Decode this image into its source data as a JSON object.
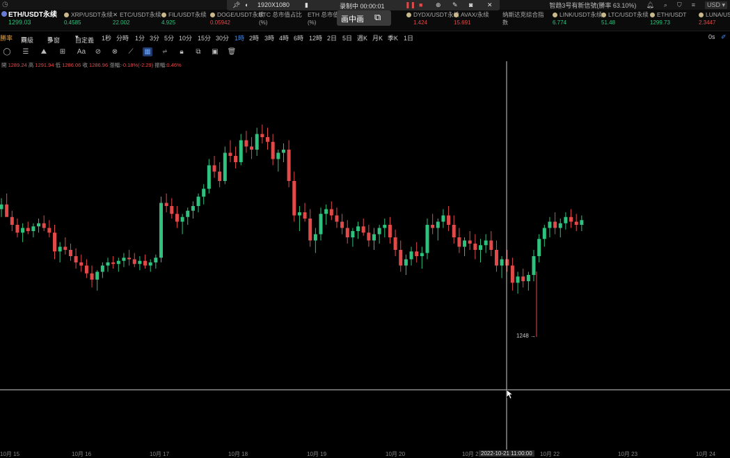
{
  "topbar": {
    "status_text": "智趋3号有新信號(勝率 63.10%)",
    "currency": "USD"
  },
  "tickers": [
    {
      "name": "ETH/USDT永续",
      "price": "1299.03",
      "dir": "up"
    },
    {
      "name": "XRP/USDT永续",
      "price": "0.4585",
      "dir": "up"
    },
    {
      "name": "ETC/USDT永续",
      "price": "22.002",
      "dir": "up"
    },
    {
      "name": "FIL/USDT永续",
      "price": "4.925",
      "dir": "up"
    },
    {
      "name": "DOGE/USDT永续",
      "price": "0.05942",
      "dir": "dn"
    },
    {
      "name": "BTC 总市值占比",
      "price": "(%)",
      "dir": "none"
    },
    {
      "name": "ETH 总市值",
      "price": "(%)",
      "dir": "none"
    },
    {
      "name": "DYDX/USDT永续",
      "price": "1.424",
      "dir": "dn"
    },
    {
      "name": "AVAX/永续",
      "price": "15.691",
      "dir": "dn"
    },
    {
      "name": "纳斯达克综合指",
      "price": "数",
      "dir": "none"
    },
    {
      "name": "LINK/USDT永续",
      "price": "6.774",
      "dir": "up"
    },
    {
      "name": "LTC/USDT永续",
      "price": "51.48",
      "dir": "up"
    },
    {
      "name": "ETH/USDT",
      "price": "1299.73",
      "dir": "up"
    },
    {
      "name": "LUNA/USDT",
      "price": "2.3447",
      "dir": "dn"
    }
  ],
  "recorder": {
    "resolution": "1920X1080",
    "status": "录制中 00:00:01",
    "pip_label": "画中画"
  },
  "timeframes": {
    "left_items": [
      "勝率",
      "商級",
      "多窗",
      "自定義"
    ],
    "periods": [
      "1秒",
      "分時",
      "1分",
      "3分",
      "5分",
      "10分",
      "15分",
      "30分",
      "1時",
      "2時",
      "3時",
      "4時",
      "6時",
      "12時",
      "2日",
      "5日",
      "週K",
      "月K",
      "季K",
      "1日"
    ],
    "selected": "1時",
    "right_label": "0s"
  },
  "ohlc": {
    "open_label": "開",
    "open": "1289.24",
    "high_label": "高",
    "high": "1291.94",
    "low_label": "低",
    "low": "1286.06",
    "close_label": "收",
    "close": "1286.96",
    "change_label": "漲幅:",
    "change": "-0.18%(-2.29)",
    "amp_label": "振幅:",
    "amp": "0.46%"
  },
  "chart_data": {
    "type": "candlestick",
    "price_marker": "1248",
    "cursor_time": "2022-10-21 11:00:00",
    "x_ticks": [
      "10月 15",
      "10月 16",
      "10月 17",
      "10月 18",
      "10月 19",
      "10月 20",
      "10月 21",
      "10月 22",
      "10月 23",
      "10月 24"
    ],
    "colors": {
      "up": "#2ec27e",
      "down": "#e24a4a",
      "crosshair": "#cfcfcf"
    },
    "candles": [
      [
        1302,
        1309,
        1297,
        1305
      ],
      [
        1305,
        1312,
        1300,
        1297
      ],
      [
        1297,
        1301,
        1288,
        1292
      ],
      [
        1292,
        1296,
        1284,
        1287
      ],
      [
        1287,
        1293,
        1281,
        1290
      ],
      [
        1290,
        1294,
        1286,
        1288
      ],
      [
        1288,
        1293,
        1284,
        1291
      ],
      [
        1291,
        1296,
        1287,
        1293
      ],
      [
        1293,
        1298,
        1288,
        1290
      ],
      [
        1290,
        1295,
        1284,
        1287
      ],
      [
        1287,
        1292,
        1270,
        1275
      ],
      [
        1275,
        1281,
        1268,
        1278
      ],
      [
        1278,
        1284,
        1273,
        1276
      ],
      [
        1276,
        1280,
        1269,
        1272
      ],
      [
        1272,
        1277,
        1264,
        1268
      ],
      [
        1268,
        1273,
        1262,
        1266
      ],
      [
        1266,
        1270,
        1258,
        1261
      ],
      [
        1261,
        1266,
        1252,
        1257
      ],
      [
        1257,
        1263,
        1250,
        1262
      ],
      [
        1262,
        1268,
        1258,
        1266
      ],
      [
        1266,
        1271,
        1262,
        1268
      ],
      [
        1268,
        1272,
        1264,
        1267
      ],
      [
        1267,
        1271,
        1262,
        1269
      ],
      [
        1269,
        1274,
        1265,
        1271
      ],
      [
        1271,
        1276,
        1266,
        1270
      ],
      [
        1270,
        1274,
        1265,
        1267
      ],
      [
        1267,
        1272,
        1263,
        1269
      ],
      [
        1269,
        1273,
        1264,
        1266
      ],
      [
        1266,
        1270,
        1262,
        1268
      ],
      [
        1268,
        1273,
        1264,
        1271
      ],
      [
        1271,
        1310,
        1268,
        1306
      ],
      [
        1306,
        1312,
        1300,
        1304
      ],
      [
        1304,
        1309,
        1296,
        1299
      ],
      [
        1299,
        1304,
        1290,
        1294
      ],
      [
        1294,
        1299,
        1286,
        1297
      ],
      [
        1297,
        1303,
        1292,
        1301
      ],
      [
        1301,
        1307,
        1296,
        1304
      ],
      [
        1304,
        1312,
        1300,
        1310
      ],
      [
        1310,
        1318,
        1305,
        1315
      ],
      [
        1315,
        1334,
        1312,
        1330
      ],
      [
        1330,
        1336,
        1322,
        1326
      ],
      [
        1326,
        1332,
        1316,
        1320
      ],
      [
        1320,
        1342,
        1318,
        1338
      ],
      [
        1338,
        1346,
        1332,
        1336
      ],
      [
        1336,
        1342,
        1328,
        1332
      ],
      [
        1332,
        1350,
        1330,
        1346
      ],
      [
        1346,
        1352,
        1338,
        1342
      ],
      [
        1342,
        1348,
        1334,
        1340
      ],
      [
        1340,
        1354,
        1336,
        1350
      ],
      [
        1350,
        1356,
        1344,
        1348
      ],
      [
        1348,
        1354,
        1340,
        1345
      ],
      [
        1345,
        1350,
        1330,
        1334
      ],
      [
        1334,
        1340,
        1326,
        1338
      ],
      [
        1338,
        1344,
        1332,
        1340
      ],
      [
        1340,
        1346,
        1316,
        1320
      ],
      [
        1320,
        1326,
        1294,
        1298
      ],
      [
        1298,
        1304,
        1288,
        1300
      ],
      [
        1300,
        1306,
        1294,
        1296
      ],
      [
        1296,
        1302,
        1278,
        1282
      ],
      [
        1282,
        1290,
        1274,
        1286
      ],
      [
        1286,
        1303,
        1282,
        1299
      ],
      [
        1299,
        1305,
        1292,
        1302
      ],
      [
        1302,
        1307,
        1295,
        1298
      ],
      [
        1298,
        1303,
        1290,
        1294
      ],
      [
        1294,
        1299,
        1286,
        1290
      ],
      [
        1290,
        1295,
        1280,
        1284
      ],
      [
        1284,
        1290,
        1278,
        1288
      ],
      [
        1288,
        1294,
        1283,
        1291
      ],
      [
        1291,
        1296,
        1285,
        1287
      ],
      [
        1287,
        1292,
        1278,
        1282
      ],
      [
        1282,
        1290,
        1276,
        1286
      ],
      [
        1286,
        1292,
        1280,
        1290
      ],
      [
        1290,
        1296,
        1284,
        1292
      ],
      [
        1292,
        1297,
        1280,
        1284
      ],
      [
        1284,
        1289,
        1272,
        1276
      ],
      [
        1276,
        1282,
        1262,
        1266
      ],
      [
        1266,
        1273,
        1260,
        1270
      ],
      [
        1270,
        1278,
        1266,
        1275
      ],
      [
        1275,
        1281,
        1268,
        1272
      ],
      [
        1272,
        1278,
        1264,
        1274
      ],
      [
        1274,
        1296,
        1270,
        1292
      ],
      [
        1292,
        1299,
        1286,
        1290
      ],
      [
        1290,
        1296,
        1282,
        1294
      ],
      [
        1294,
        1302,
        1290,
        1298
      ],
      [
        1298,
        1304,
        1288,
        1292
      ],
      [
        1292,
        1298,
        1280,
        1284
      ],
      [
        1284,
        1290,
        1274,
        1278
      ],
      [
        1278,
        1284,
        1272,
        1282
      ],
      [
        1282,
        1288,
        1276,
        1280
      ],
      [
        1280,
        1286,
        1270,
        1276
      ],
      [
        1276,
        1283,
        1268,
        1279
      ],
      [
        1279,
        1286,
        1274,
        1282
      ],
      [
        1282,
        1288,
        1272,
        1276
      ],
      [
        1276,
        1282,
        1262,
        1266
      ],
      [
        1266,
        1272,
        1258,
        1270
      ],
      [
        1270,
        1276,
        1262,
        1266
      ],
      [
        1266,
        1271,
        1250,
        1255
      ],
      [
        1255,
        1262,
        1248,
        1259
      ],
      [
        1259,
        1264,
        1252,
        1256
      ],
      [
        1256,
        1262,
        1250,
        1260
      ],
      [
        1260,
        1276,
        1256,
        1272
      ],
      [
        1272,
        1286,
        1268,
        1283
      ],
      [
        1283,
        1292,
        1278,
        1290
      ],
      [
        1290,
        1297,
        1284,
        1294
      ],
      [
        1294,
        1300,
        1286,
        1290
      ],
      [
        1290,
        1296,
        1284,
        1293
      ],
      [
        1293,
        1300,
        1289,
        1297
      ],
      [
        1297,
        1302,
        1290,
        1294
      ],
      [
        1294,
        1299,
        1288,
        1292
      ],
      [
        1292,
        1298,
        1288,
        1295
      ]
    ]
  }
}
